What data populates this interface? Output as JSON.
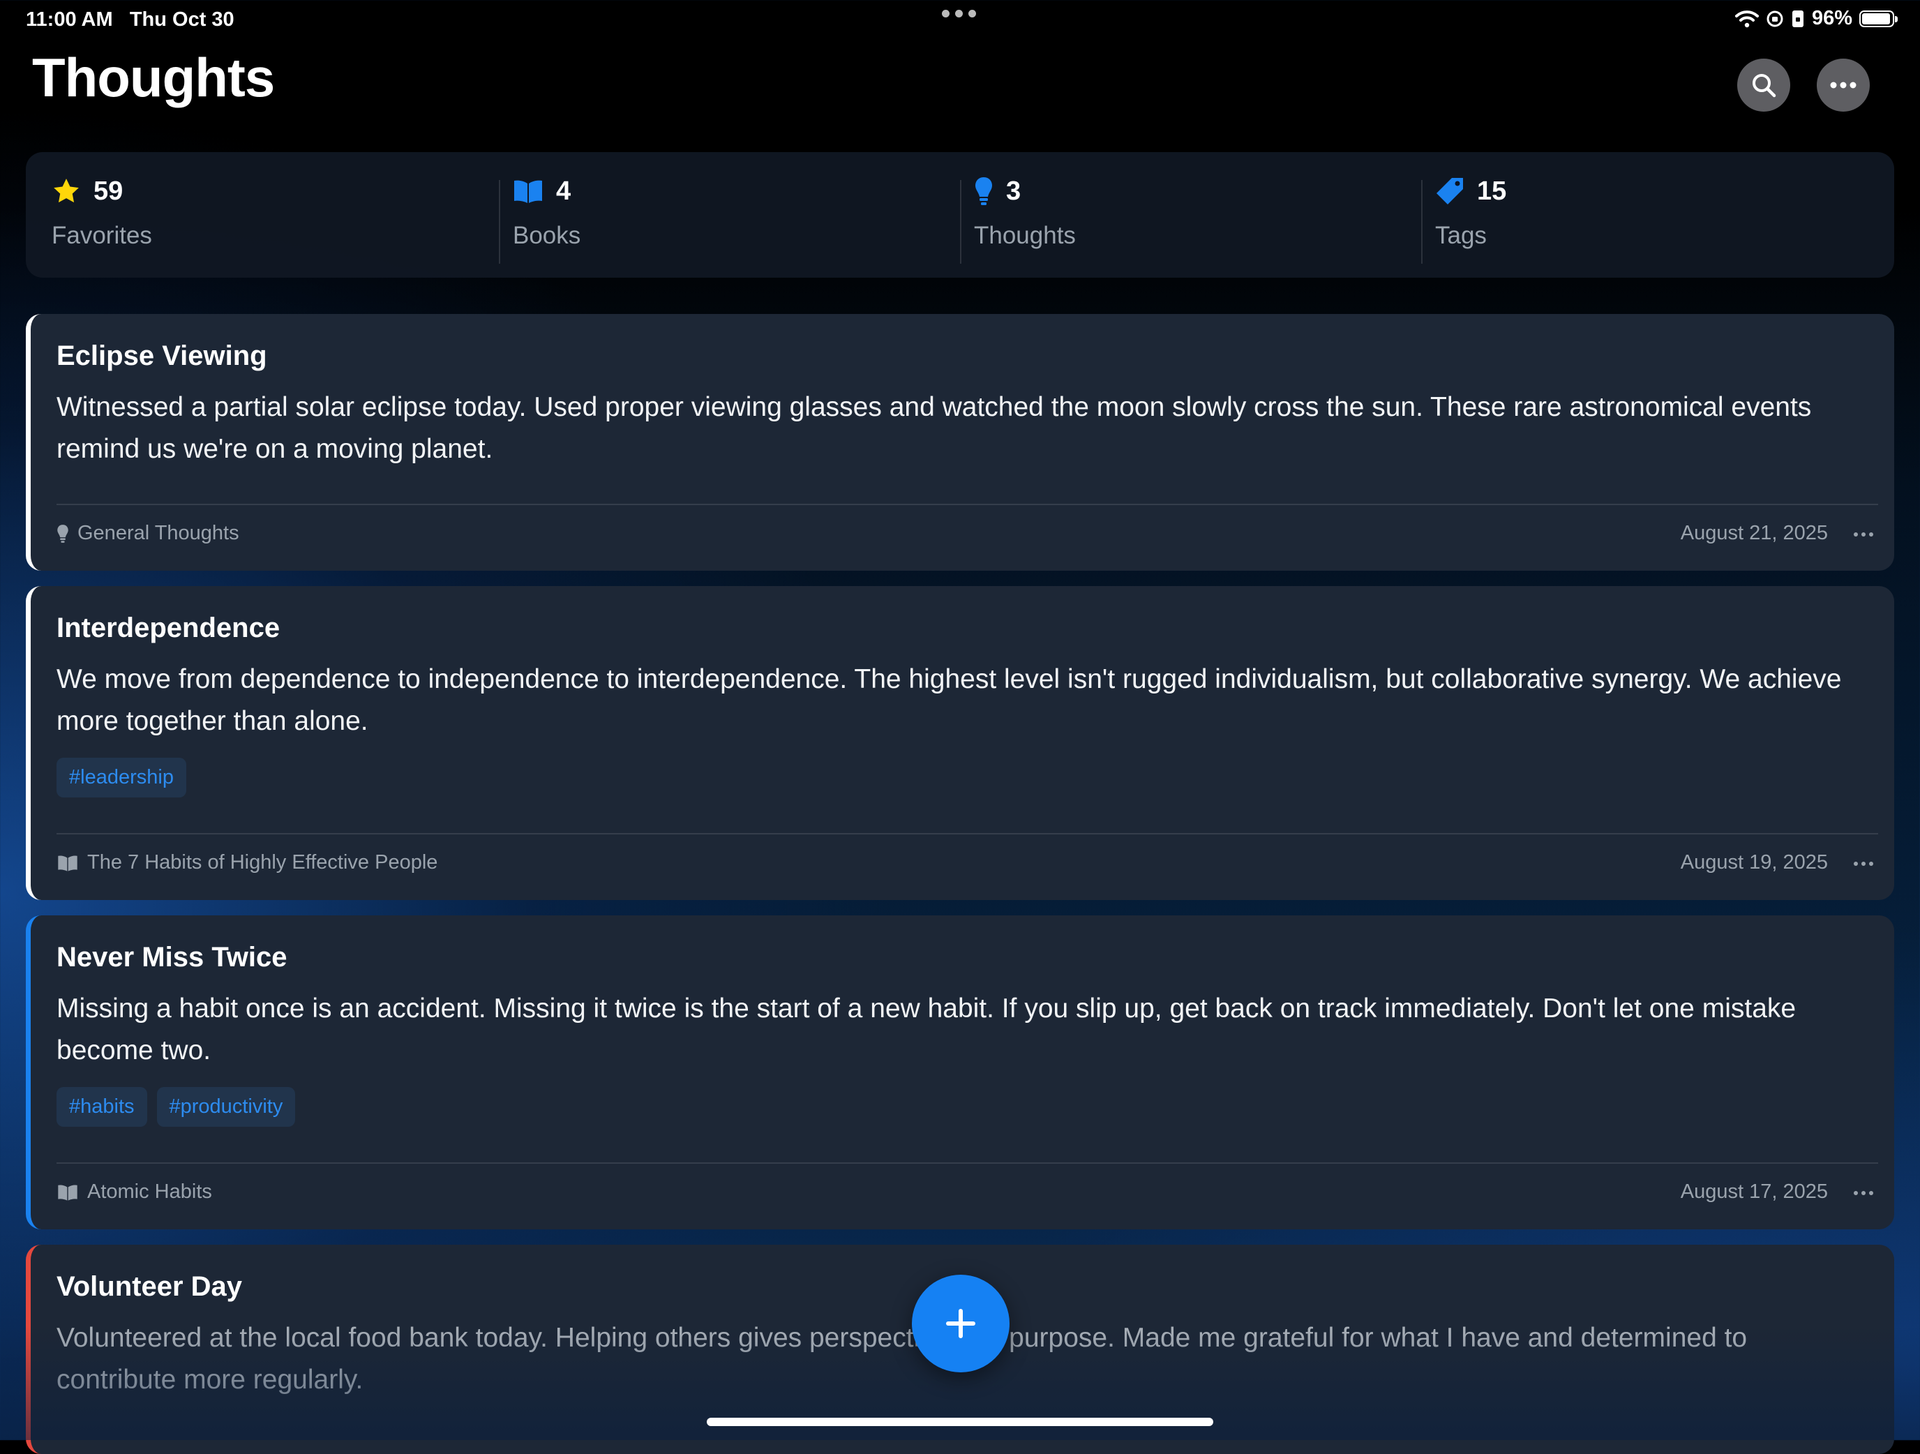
{
  "status_bar": {
    "time": "11:00 AM",
    "date": "Thu Oct 30",
    "battery": "96%",
    "battery_level": 0.96
  },
  "header": {
    "title": "Thoughts",
    "search_icon": "magnifying-glass-icon",
    "more_icon": "ellipsis-icon"
  },
  "stats": [
    {
      "value": "59",
      "label": "Favorites",
      "icon": "star-icon",
      "color": "#FFD60A"
    },
    {
      "value": "4",
      "label": "Books",
      "icon": "book-icon",
      "color": "#1A82F0"
    },
    {
      "value": "3",
      "label": "Thoughts",
      "icon": "lightbulb-icon",
      "color": "#1A82F0"
    },
    {
      "value": "15",
      "label": "Tags",
      "icon": "tag-icon",
      "color": "#1A82F0"
    }
  ],
  "cards": [
    {
      "title": "Eclipse Viewing",
      "body": "Witnessed a partial solar eclipse today. Used proper viewing glasses and watched the moon slowly cross the sun. These rare astronomical events remind us we're on a moving planet.",
      "tags": [],
      "source": "General Thoughts",
      "source_icon": "lightbulb-icon",
      "date": "August 21, 2025",
      "accent": "#FFFFFF"
    },
    {
      "title": "Interdependence",
      "body": "We move from dependence to independence to interdependence. The highest level isn't rugged individualism, but collaborative synergy. We achieve more together than alone.",
      "tags": [
        "#leadership"
      ],
      "source": "The 7 Habits of Highly Effective People",
      "source_icon": "book-icon",
      "date": "August 19, 2025",
      "accent": "#FFFFFF"
    },
    {
      "title": "Never Miss Twice",
      "body": "Missing a habit once is an accident. Missing it twice is the start of a new habit. If you slip up, get back on track immediately. Don't let one mistake become two.",
      "tags": [
        "#habits",
        "#productivity"
      ],
      "source": "Atomic Habits",
      "source_icon": "book-icon",
      "date": "August 17, 2025",
      "accent": "#1A82F0"
    },
    {
      "title": "Volunteer Day",
      "body": "Volunteered at the local food bank today. Helping others gives perspective and purpose. Made me grateful for what I have and determined to contribute more regularly.",
      "tags": [],
      "source": "",
      "source_icon": "",
      "date": "",
      "accent": "#E5483E"
    }
  ],
  "fab": {
    "icon": "plus-icon"
  }
}
